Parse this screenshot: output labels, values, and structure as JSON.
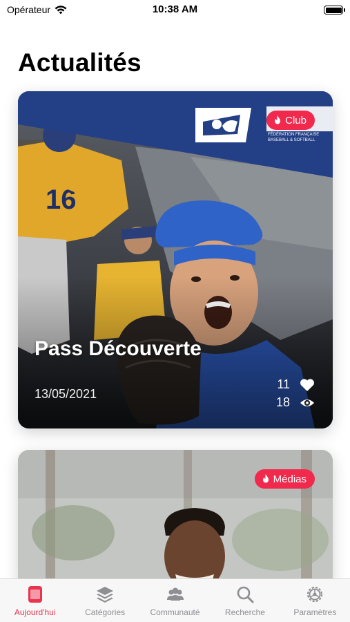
{
  "status_bar": {
    "carrier": "Opérateur",
    "time": "10:38 AM"
  },
  "page": {
    "title": "Actualités"
  },
  "cards": [
    {
      "badge": "Club",
      "title": "Pass Découverte",
      "date": "13/05/2021",
      "likes": "11",
      "views": "18",
      "logo_text": "FÉDÉRATION FRANÇAISE\nBASEBALL & SOFTBALL"
    },
    {
      "badge": "Médias"
    }
  ],
  "tabs": [
    {
      "label": "Aujourd'hui",
      "icon": "today-icon",
      "active": true
    },
    {
      "label": "Catégories",
      "icon": "layers-icon"
    },
    {
      "label": "Communauté",
      "icon": "community-icon"
    },
    {
      "label": "Recherche",
      "icon": "search-icon"
    },
    {
      "label": "Paramètres",
      "icon": "gear-icon"
    }
  ],
  "colors": {
    "accent": "#e8344f",
    "badge": "#f0294d",
    "federation_blue": "#233f86"
  }
}
